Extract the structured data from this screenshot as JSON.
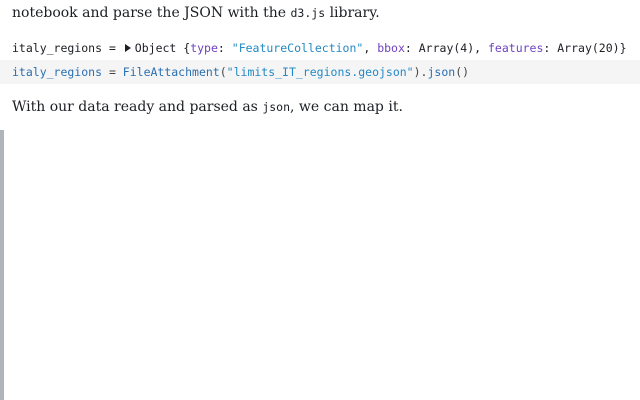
{
  "prose_top": {
    "part1": "notebook and parse the JSON with the ",
    "code": "d3.js",
    "part2": " library."
  },
  "output_cell": {
    "var_name": "italy_regions",
    "equals": " = ",
    "object_label": "Object ",
    "open": "{",
    "key1": "type",
    "val1": "\"FeatureCollection\"",
    "key2": "bbox",
    "val2": "Array(4)",
    "key3": "features",
    "val3": "Array(20)",
    "close": "}"
  },
  "input_cell": {
    "var_name": "italy_regions",
    "equals": " = ",
    "fn": "FileAttachment",
    "open_paren": "(",
    "arg": "\"limits_IT_regions.geojson\"",
    "close_paren": ")",
    "dot": ".",
    "method": "json",
    "call": "()"
  },
  "prose_bottom": {
    "part1": "With our data ready and parsed as ",
    "code": "json",
    "part2": ", we can map it."
  }
}
